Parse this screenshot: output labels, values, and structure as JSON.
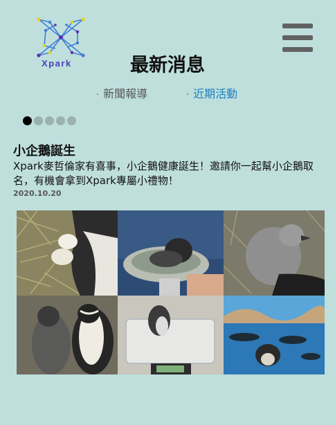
{
  "header": {
    "logo_text": "Xpark",
    "page_title": "最新消息"
  },
  "tabs": [
    {
      "bullet": "·",
      "label": "新聞報導",
      "active": false
    },
    {
      "bullet": "·",
      "label": "近期活動",
      "active": true
    }
  ],
  "carousel": {
    "slide_count": 5,
    "active_index": 0
  },
  "article": {
    "title": "小企鵝誕生",
    "body": "Xpark麥哲倫家有喜事，小企鵝健康誕生！邀請你一起幫小企鵝取名，有機會拿到Xpark專屬小禮物！",
    "date": "2020.10.20"
  },
  "colors": {
    "background": "#bfdfdd",
    "active_tab": "#1f7fc0",
    "menu_icon": "#626262",
    "logo": "#4a3fb8"
  }
}
